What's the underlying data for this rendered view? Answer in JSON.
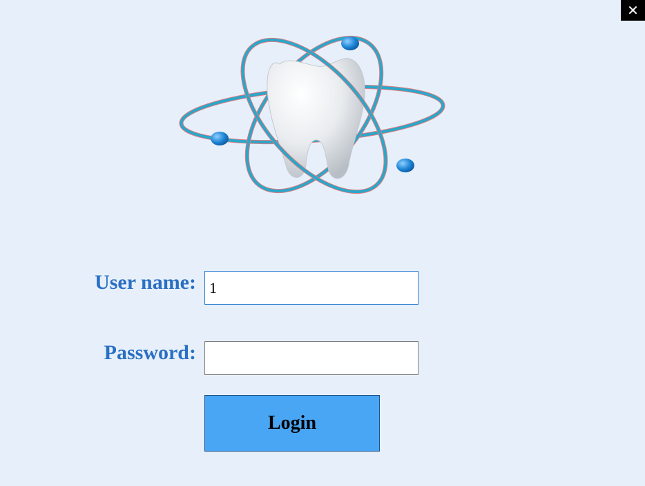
{
  "window": {
    "close_label": "✕"
  },
  "logo": {
    "icon": "tooth-atom-logo"
  },
  "form": {
    "username_label": "User name:",
    "username_value": "1",
    "password_label": "Password:",
    "password_value": "",
    "login_label": "Login"
  },
  "colors": {
    "background": "#e7f0fa",
    "label_text": "#2a6fc4",
    "login_button": "#48a6f4"
  }
}
